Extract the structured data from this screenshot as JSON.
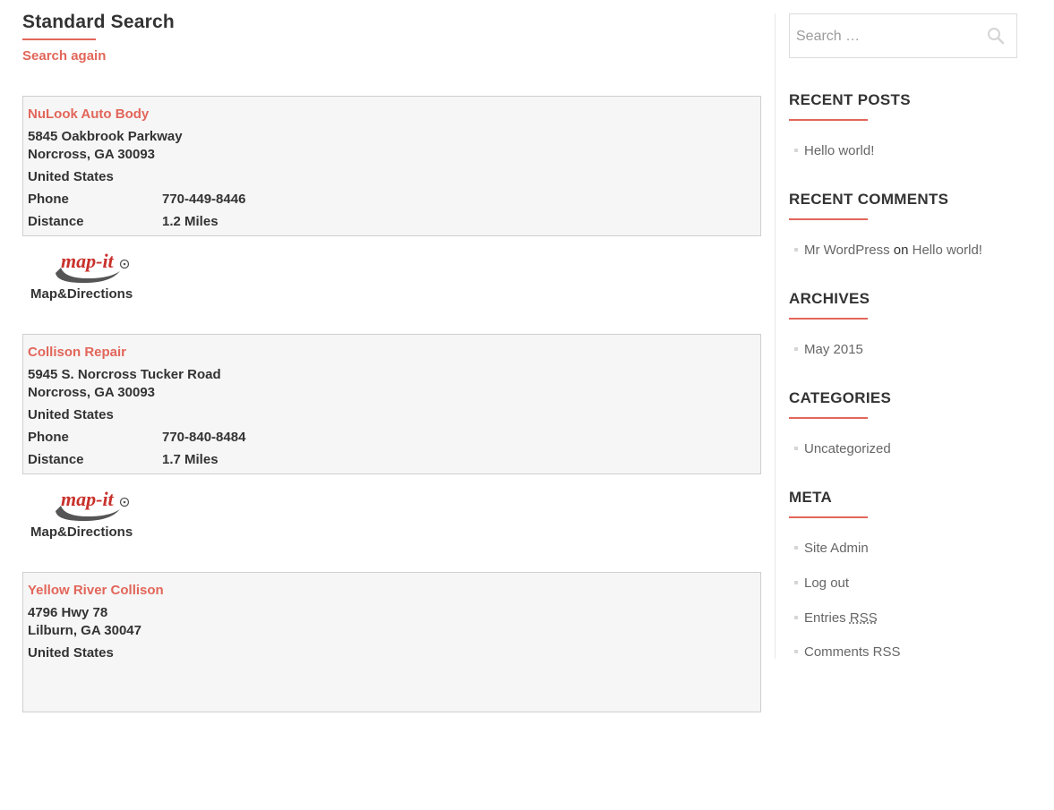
{
  "page": {
    "title": "Standard Search",
    "search_again": "Search again"
  },
  "results": [
    {
      "name": "NuLook Auto Body",
      "address1": "5845 Oakbrook Parkway",
      "address2": "Norcross, GA 30093",
      "country": "United States",
      "phone_label": "Phone",
      "phone": "770-449-8446",
      "distance_label": "Distance",
      "distance": "1.2 Miles",
      "map_logo": "map-it",
      "map_caption": "Map&Directions"
    },
    {
      "name": "Collison Repair",
      "address1": "5945 S. Norcross Tucker Road",
      "address2": "Norcross, GA 30093",
      "country": "United States",
      "phone_label": "Phone",
      "phone": "770-840-8484",
      "distance_label": "Distance",
      "distance": "1.7 Miles",
      "map_logo": "map-it",
      "map_caption": "Map&Directions"
    },
    {
      "name": "Yellow River Collison",
      "address1": "4796 Hwy 78",
      "address2": "Lilburn, GA 30047",
      "country": "United States",
      "phone_label": "",
      "phone": "",
      "distance_label": "",
      "distance": "",
      "map_logo": "",
      "map_caption": ""
    }
  ],
  "sidebar": {
    "search_placeholder": "Search …",
    "search_icon": "search-icon",
    "recent_posts": {
      "title": "RECENT POSTS",
      "items": [
        "Hello world!"
      ]
    },
    "recent_comments": {
      "title": "RECENT COMMENTS",
      "author": "Mr WordPress",
      "on": "on",
      "post": "Hello world!"
    },
    "archives": {
      "title": "ARCHIVES",
      "items": [
        "May 2015"
      ]
    },
    "categories": {
      "title": "CATEGORIES",
      "items": [
        "Uncategorized"
      ]
    },
    "meta": {
      "title": "META",
      "site_admin": "Site Admin",
      "log_out": "Log out",
      "entries_prefix": "Entries",
      "entries_rss": "RSS",
      "comments_rss": "Comments RSS"
    }
  },
  "colors": {
    "accent": "#e2665a",
    "text": "#333333",
    "muted": "#666666",
    "card_bg": "#f6f6f6",
    "card_border": "#cfcfcf"
  }
}
